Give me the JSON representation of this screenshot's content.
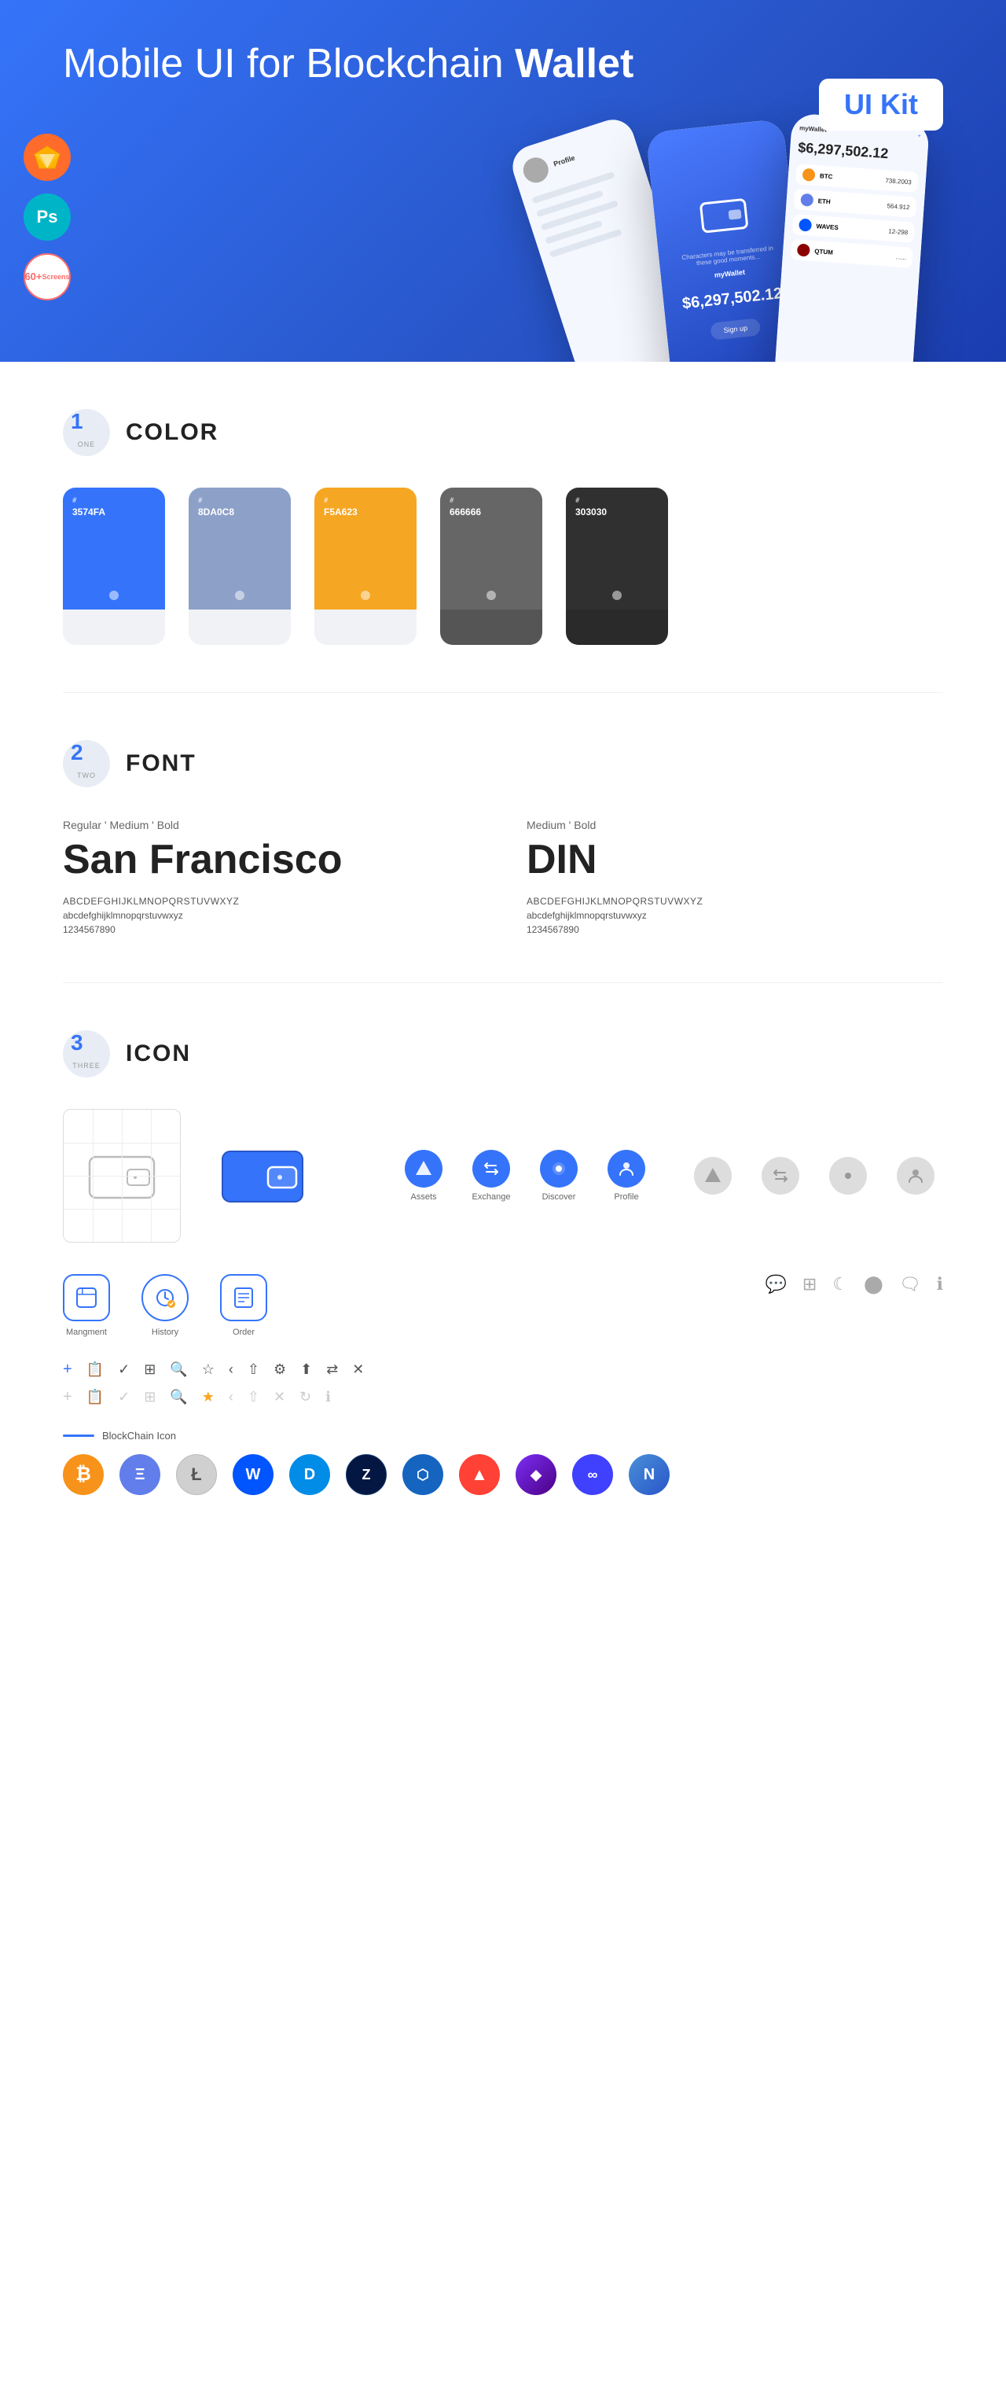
{
  "hero": {
    "title_regular": "Mobile UI for Blockchain ",
    "title_bold": "Wallet",
    "badge": "UI Kit",
    "badge_sketch": "Sketch",
    "badge_ps": "Ps",
    "badge_screens": "60+\nScreens"
  },
  "sections": {
    "color": {
      "number": "1",
      "label": "ONE",
      "title": "COLOR",
      "swatches": [
        {
          "id": "blue",
          "hex": "#3574FA",
          "code": "3574FA",
          "dark": false
        },
        {
          "id": "slate",
          "hex": "#8DA0C8",
          "code": "8DA0C8",
          "dark": false
        },
        {
          "id": "orange",
          "hex": "#F5A623",
          "code": "F5A623",
          "dark": false
        },
        {
          "id": "grey",
          "hex": "#666666",
          "code": "666666",
          "dark": true
        },
        {
          "id": "dark",
          "hex": "#303030",
          "code": "303030",
          "dark": true
        }
      ]
    },
    "font": {
      "number": "2",
      "label": "TWO",
      "title": "FONT",
      "fonts": [
        {
          "weights": "Regular ' Medium ' Bold",
          "name": "San Francisco",
          "style": "sf",
          "uppercase": "ABCDEFGHIJKLMNOPQRSTUVWXYZ",
          "lowercase": "abcdefghijklmnopqrstuvwxyz",
          "numbers": "1234567890"
        },
        {
          "weights": "Medium ' Bold",
          "name": "DIN",
          "style": "din",
          "uppercase": "ABCDEFGHIJKLMNOPQRSTUVWXYZ",
          "lowercase": "abcdefghijklmnopqrstuvwxyz",
          "numbers": "1234567890"
        }
      ]
    },
    "icon": {
      "number": "3",
      "label": "THREE",
      "title": "ICON",
      "nav_icons": [
        {
          "label": "Assets",
          "color": "#3574FA"
        },
        {
          "label": "Exchange",
          "color": "#3574FA"
        },
        {
          "label": "Discover",
          "color": "#3574FA"
        },
        {
          "label": "Profile",
          "color": "#3574FA"
        }
      ],
      "app_icons": [
        {
          "label": "Mangment"
        },
        {
          "label": "History"
        },
        {
          "label": "Order"
        }
      ],
      "blockchain_label": "BlockChain Icon",
      "crypto": [
        {
          "label": "BTC",
          "color": "#F7931A",
          "symbol": "₿"
        },
        {
          "label": "ETH",
          "color": "#627EEA",
          "symbol": "Ξ"
        },
        {
          "label": "LTC",
          "color": "#BFBBBB",
          "symbol": "Ł"
        },
        {
          "label": "WAVES",
          "color": "#0055FF",
          "symbol": "W"
        },
        {
          "label": "DASH",
          "color": "#008CE7",
          "symbol": "D"
        },
        {
          "label": "ZEN",
          "color": "#041742",
          "symbol": "Z"
        },
        {
          "label": "NET",
          "color": "#1565C0",
          "symbol": "⬡"
        },
        {
          "label": "ARK",
          "color": "#FF4136",
          "symbol": "▲"
        },
        {
          "label": "GEM",
          "color": "#4B0082",
          "symbol": "◆"
        },
        {
          "label": "POLY",
          "color": "#4040FF",
          "symbol": "∞"
        },
        {
          "label": "NANO",
          "color": "#4A90D9",
          "symbol": "N"
        }
      ]
    }
  }
}
